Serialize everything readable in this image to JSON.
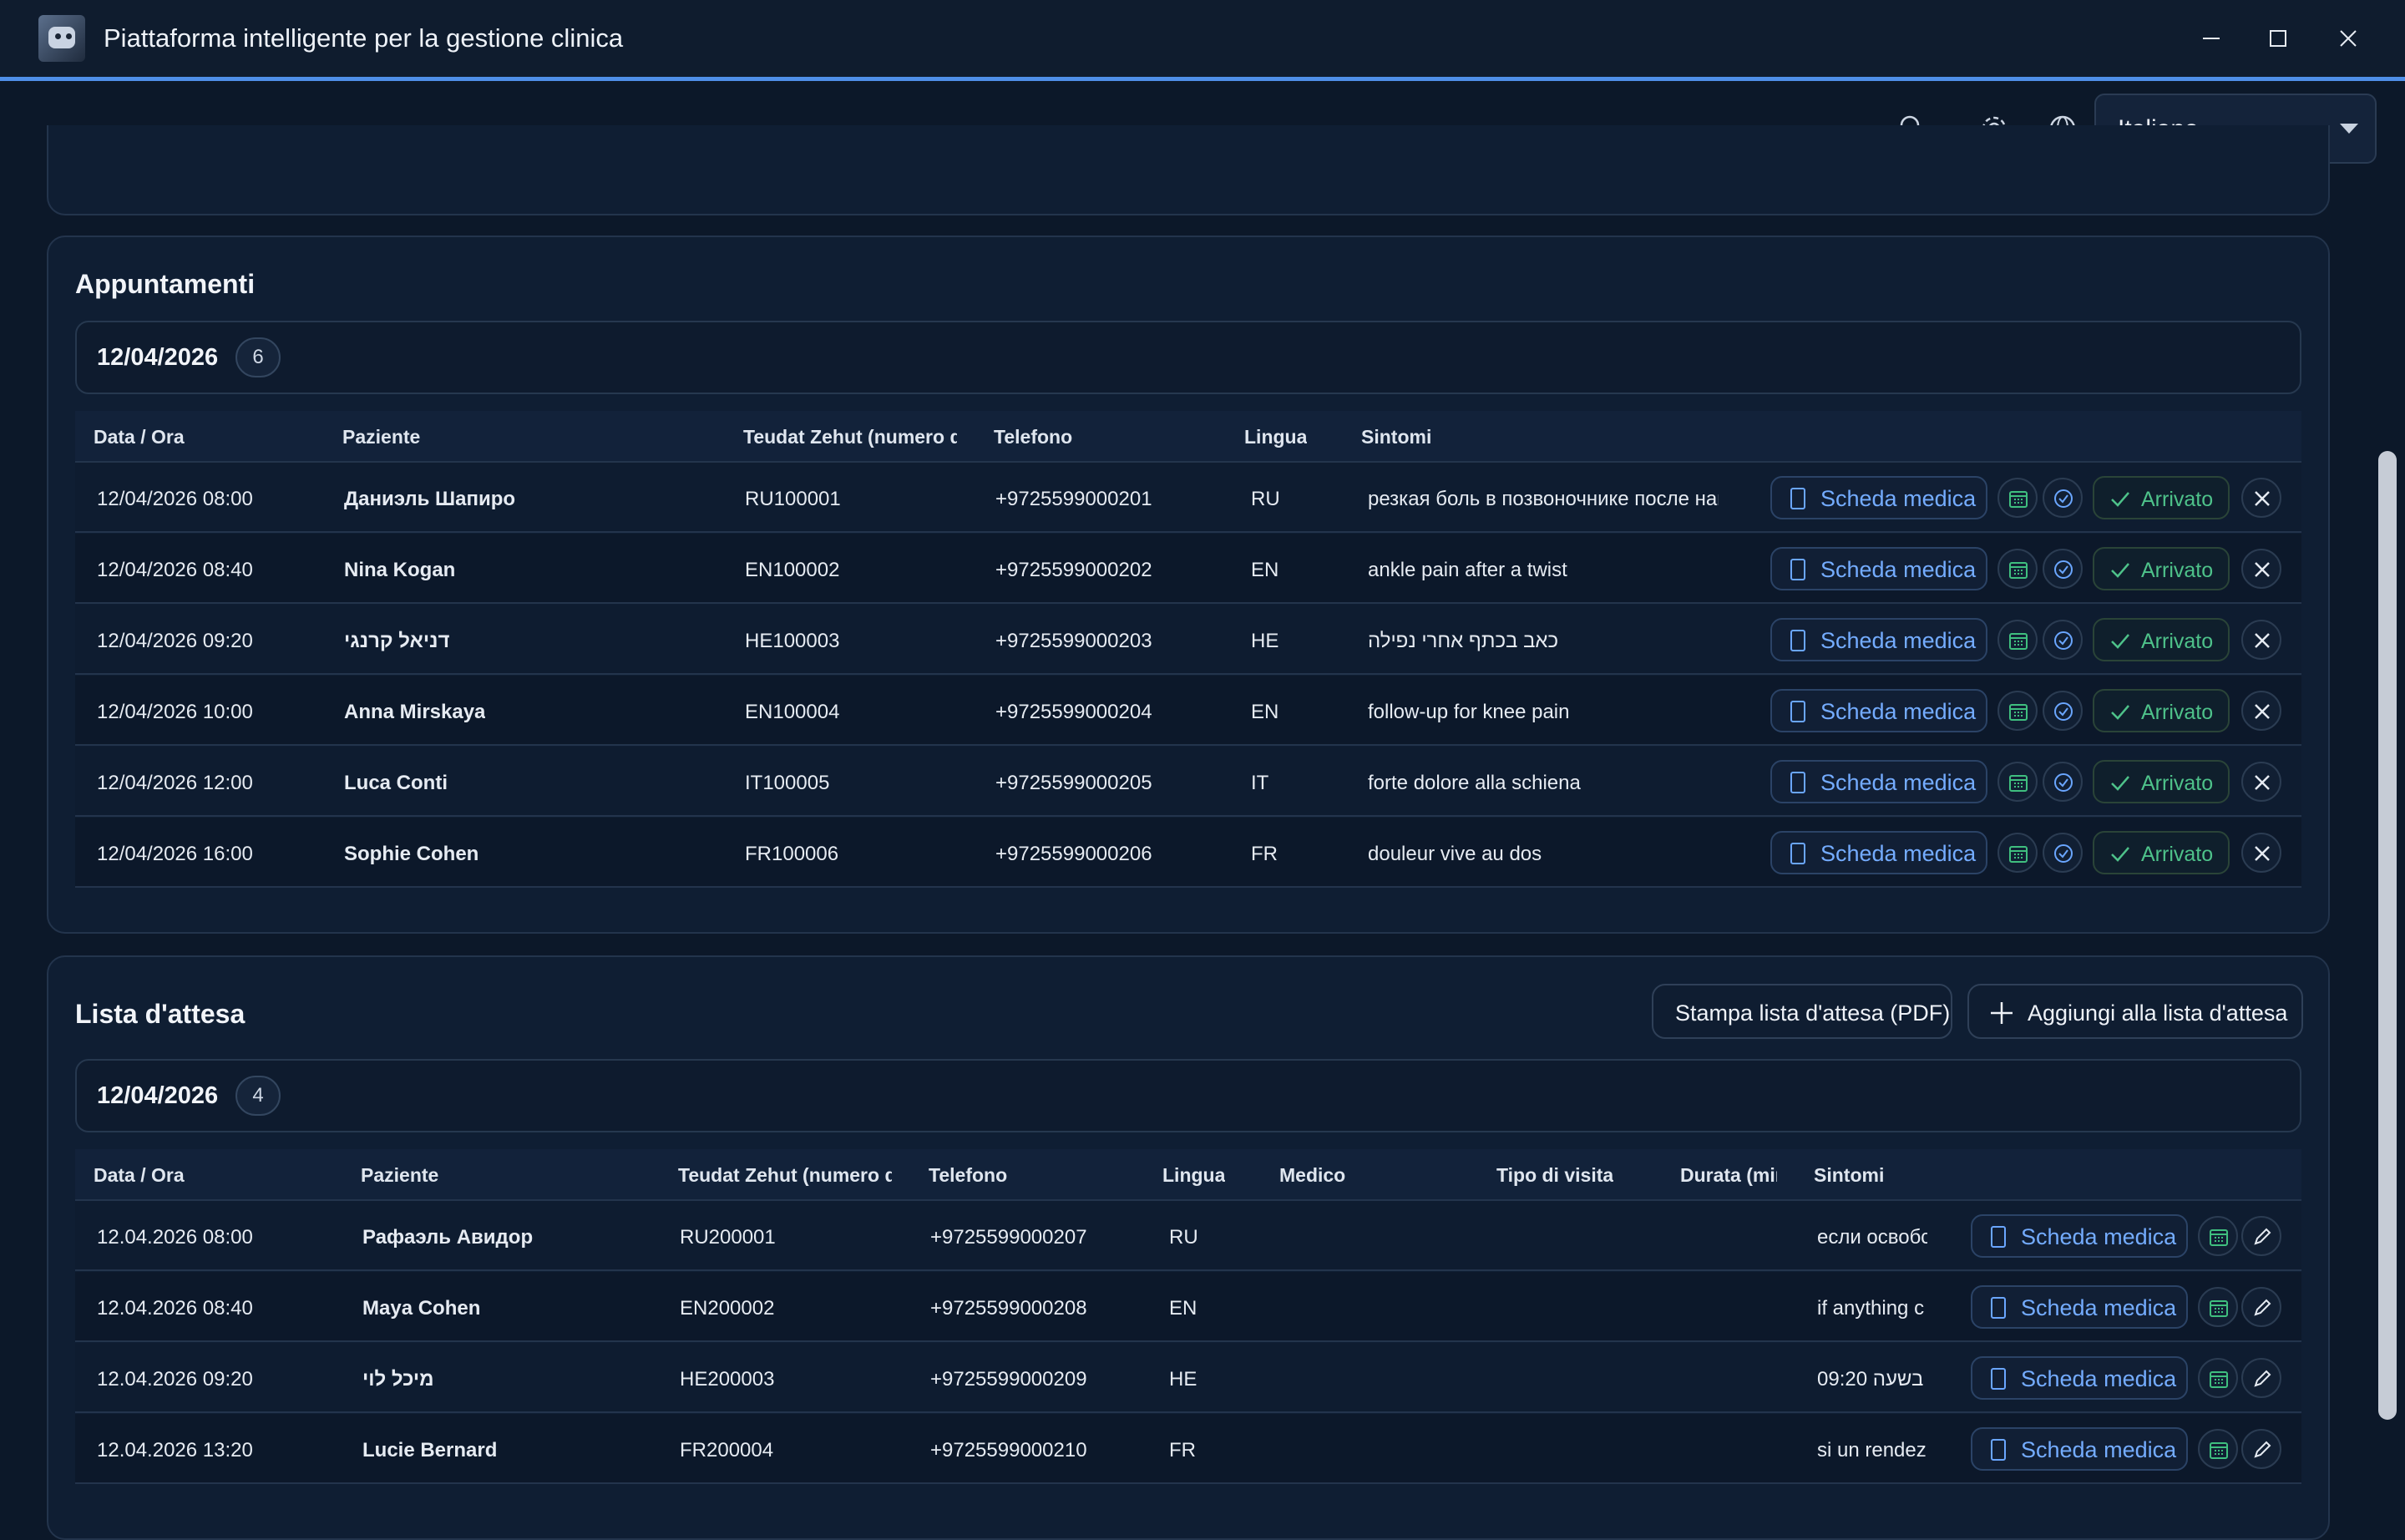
{
  "app": {
    "title": "Piattaforma intelligente per la gestione clinica"
  },
  "toolbar": {
    "language": "Italiano"
  },
  "appointments": {
    "title": "Appuntamenti",
    "date": "12/04/2026",
    "count": "6",
    "columns": [
      "Data / Ora",
      "Paziente",
      "Teudat Zehut (numero d'i",
      "Telefono",
      "Lingua",
      "Sintomi"
    ],
    "record_label": "Scheda medica",
    "arrived_label": "Arrivato",
    "rows": [
      {
        "datetime": "12/04/2026 08:00",
        "patient": "Даниэль Шапиро",
        "id": "RU100001",
        "phone": "+9725599000201",
        "lang": "RU",
        "symptoms": "резкая боль в позвоночнике после нак"
      },
      {
        "datetime": "12/04/2026 08:40",
        "patient": "Nina Kogan",
        "id": "EN100002",
        "phone": "+9725599000202",
        "lang": "EN",
        "symptoms": "ankle pain after a twist"
      },
      {
        "datetime": "12/04/2026 09:20",
        "patient": "דניאל קרנגי",
        "id": "HE100003",
        "phone": "+9725599000203",
        "lang": "HE",
        "symptoms": "כאב בכתף אחרי נפילה"
      },
      {
        "datetime": "12/04/2026 10:00",
        "patient": "Anna Mirskaya",
        "id": "EN100004",
        "phone": "+9725599000204",
        "lang": "EN",
        "symptoms": "follow-up for knee pain"
      },
      {
        "datetime": "12/04/2026 12:00",
        "patient": "Luca Conti",
        "id": "IT100005",
        "phone": "+9725599000205",
        "lang": "IT",
        "symptoms": "forte dolore alla schiena"
      },
      {
        "datetime": "12/04/2026 16:00",
        "patient": "Sophie Cohen",
        "id": "FR100006",
        "phone": "+9725599000206",
        "lang": "FR",
        "symptoms": "douleur vive au dos"
      }
    ]
  },
  "waitlist": {
    "title": "Lista d'attesa",
    "print_label": "Stampa lista d'attesa (PDF)",
    "add_label": "Aggiungi alla lista d'attesa",
    "date": "12/04/2026",
    "count": "4",
    "columns": [
      "Data / Ora",
      "Paziente",
      "Teudat Zehut (numero d'i",
      "Telefono",
      "Lingua",
      "Medico",
      "Tipo di visita",
      "Durata (mir",
      "Sintomi"
    ],
    "record_label": "Scheda medica",
    "rows": [
      {
        "datetime": "12.04.2026 08:00",
        "patient": "Рафаэль Авидор",
        "id": "RU200001",
        "phone": "+9725599000207",
        "lang": "RU",
        "symptoms": "если освобс"
      },
      {
        "datetime": "12.04.2026 08:40",
        "patient": "Maya Cohen",
        "id": "EN200002",
        "phone": "+9725599000208",
        "lang": "EN",
        "symptoms": "if anything c"
      },
      {
        "datetime": "12.04.2026 09:20",
        "patient": "מיכל לוי",
        "id": "HE200003",
        "phone": "+9725599000209",
        "lang": "HE",
        "symptoms": "בשעה 09:20"
      },
      {
        "datetime": "12.04.2026 13:20",
        "patient": "Lucie Bernard",
        "id": "FR200004",
        "phone": "+9725599000210",
        "lang": "FR",
        "symptoms": "si un rendez"
      }
    ]
  }
}
